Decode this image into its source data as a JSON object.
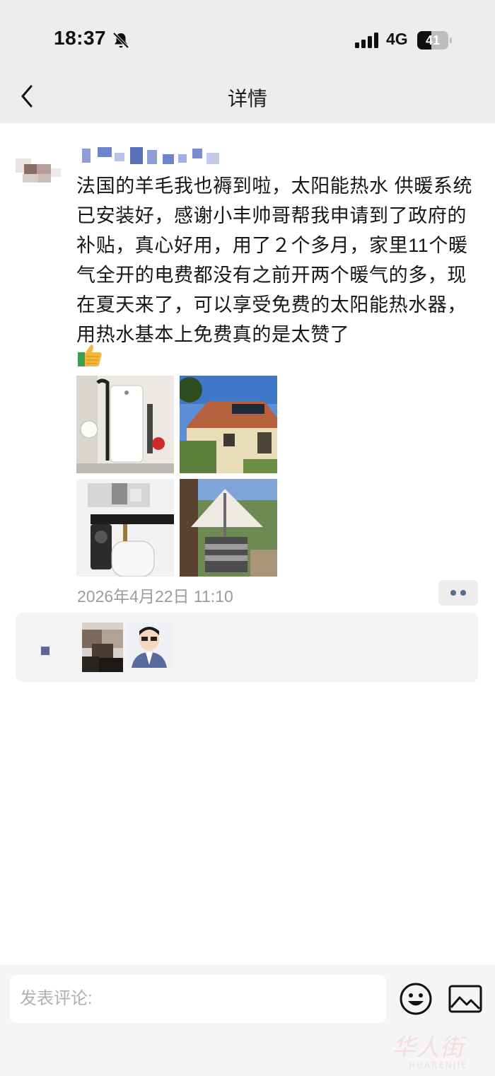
{
  "status_bar": {
    "time": "18:37",
    "network": "4G",
    "battery": "41"
  },
  "nav": {
    "title": "详情"
  },
  "post": {
    "text": "法国的羊毛我也褥到啦，太阳能热水 供暖系统已安装好，感谢小丰帅哥帮我申请到了政府的补贴，真心好用，用了２个多月，家里11个暖气全开的电费都没有之前开两个暖气的多，现在夏天来了，可以享受免费的太阳能热水器，用热水基本上免费真的是太赞了",
    "timestamp": "2026年4月22日 11:10",
    "photos": [
      "water-tank-photo",
      "house-solar-panels-photo",
      "pump-equipment-photo",
      "garden-umbrella-photo"
    ]
  },
  "comment_bar": {
    "placeholder": "发表评论:"
  },
  "watermark": {
    "text": "华人街",
    "sub": "HUARENJIE"
  },
  "colors": {
    "top_bg": "#ededed",
    "link_blue": "#576b95",
    "timestamp_gray": "#9c9c9c",
    "likes_bg": "#f3f3f5"
  }
}
